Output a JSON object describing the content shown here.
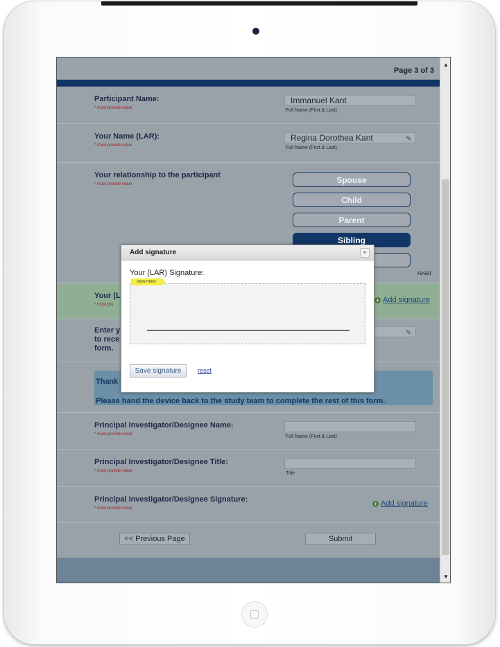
{
  "page": {
    "indicator": "Page 3 of 3"
  },
  "form": {
    "participant_name": {
      "label": "Participant Name:",
      "required": "* must provide value",
      "value": "Immanuel Kant",
      "hint": "Full Name (First & Last)"
    },
    "lar_name": {
      "label": "Your Name (LAR):",
      "required": "* must provide value",
      "value": "Regina Dorothea Kant",
      "hint": "Full Name (First & Last)"
    },
    "relationship": {
      "label": "Your relationship to the participant",
      "required": "* must provide value",
      "options": [
        "Spouse",
        "Child",
        "Parent",
        "Sibling"
      ],
      "selected": "Sibling",
      "reset": "reset"
    },
    "lar_signature": {
      "label_partial": "Your (L",
      "required_partial": "* must pro",
      "add": "Add signature"
    },
    "enter_row": {
      "line1": "Enter y",
      "line2": "to rece",
      "line3": "form."
    },
    "thank_you": {
      "partial": "Thank",
      "instruction": "Please hand the device back to the study team to complete the rest of this form."
    },
    "pi_name": {
      "label": "Principal Investigator/Designee Name:",
      "required": "* must provide value",
      "value": "",
      "hint": "Full Name (First & Last)"
    },
    "pi_title": {
      "label": "Principal Investigator/Designee Title:",
      "required": "* must provide value",
      "value": "",
      "hint": "Title"
    },
    "pi_signature": {
      "label": "Principal Investigator/Designee Signature:",
      "required": "* must provide value",
      "add": "Add signature"
    },
    "nav": {
      "previous": "<< Previous Page",
      "submit": "Submit"
    }
  },
  "dialog": {
    "title": "Add signature",
    "close": "×",
    "prompt": "Your (LAR) Signature:",
    "sign_here": "SIGN HERE",
    "save": "Save signature",
    "reset": "reset"
  },
  "colors": {
    "header_bar": "#103566",
    "selected_option": "#103566",
    "accent_green": "#4e7a3e"
  }
}
